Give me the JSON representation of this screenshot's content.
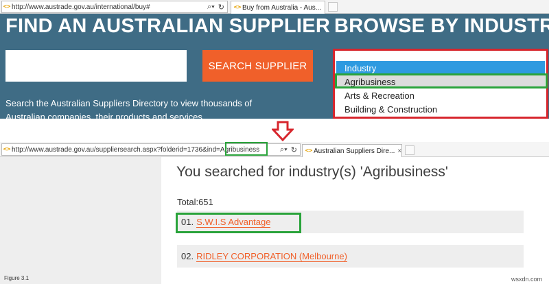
{
  "browser_top": {
    "address": "http://www.austrade.gov.au/international/buy#",
    "address_domain": "austrade.gov.au",
    "tab_title": "Buy from Australia - Aus...",
    "tab_close": "×"
  },
  "top_page": {
    "find_title": "FIND AN AUSTRALIAN SUPPLIER",
    "browse_title": "BROWSE BY INDUSTRY",
    "search_button": "SEARCH SUPPLIER",
    "search_input_value": "",
    "description": "Search the Australian Suppliers Directory to view thousands of Australian companies, their products and services",
    "industry_options": [
      "Industry",
      "Agribusiness",
      "Arts & Recreation",
      "Building & Construction"
    ]
  },
  "browser_bottom": {
    "address": "http://www.austrade.gov.au/suppliersearch.aspx?folderid=1736&ind=Agribusiness",
    "tab_title": "Australian Suppliers Dire...",
    "tab_close": "×"
  },
  "results": {
    "title": "You searched for industry(s) 'Agribusiness'",
    "total": "Total:651",
    "items": [
      {
        "num": "01.",
        "name": "S.W.I.S Advantage"
      },
      {
        "num": "02.",
        "name": "RIDLEY CORPORATION (Melbourne)"
      }
    ]
  },
  "caption": "Figure 3.1",
  "watermark": "wsxdn.com",
  "colors": {
    "header_bg": "#3f6c85",
    "accent_orange": "#f0602a",
    "highlight_red": "#d7262d",
    "highlight_green": "#29a33a",
    "selected_blue": "#2e9ae0"
  }
}
